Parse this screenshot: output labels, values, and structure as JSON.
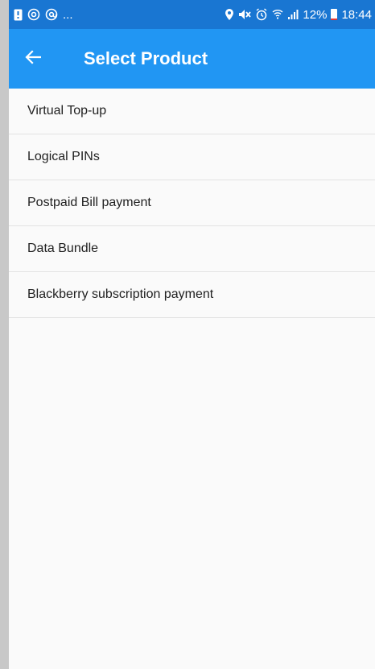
{
  "status_bar": {
    "left_ellipsis": "...",
    "battery_text": "12%",
    "battery_level": 0.12,
    "time": "18:44",
    "icons_left": [
      "notification-icon",
      "sync-icon",
      "at-icon"
    ],
    "icons_right": [
      "location-icon",
      "mute-icon",
      "alarm-icon",
      "wifi-icon",
      "signal-icon",
      "battery-icon"
    ]
  },
  "app_bar": {
    "title": "Select Product",
    "back_icon": "arrow-left-icon",
    "color": "#2196f3",
    "status_color": "#1976d2"
  },
  "products": [
    {
      "label": "Virtual Top-up"
    },
    {
      "label": "Logical PINs"
    },
    {
      "label": "Postpaid Bill payment"
    },
    {
      "label": "Data Bundle"
    },
    {
      "label": "Blackberry subscription payment"
    }
  ]
}
